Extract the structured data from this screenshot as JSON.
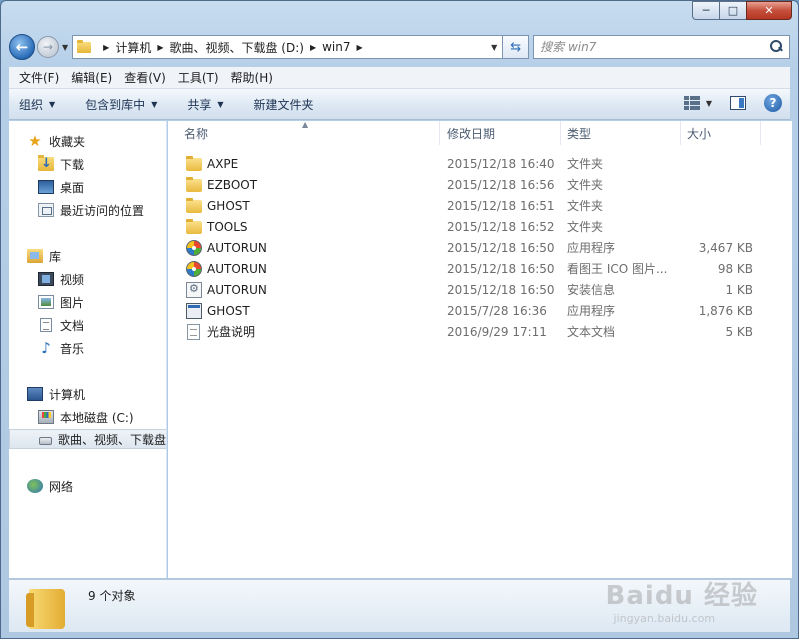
{
  "window": {
    "caption": {
      "minimize": "─",
      "maximize": "□",
      "close": "✕"
    }
  },
  "address": {
    "crumbs": [
      "计算机",
      "歌曲、视频、下载盘 (D:)",
      "win7"
    ],
    "search_placeholder": "搜索 win7"
  },
  "menu": [
    "文件(F)",
    "编辑(E)",
    "查看(V)",
    "工具(T)",
    "帮助(H)"
  ],
  "commands": {
    "organize": "组织",
    "include_in_library": "包含到库中",
    "share": "共享",
    "new_folder": "新建文件夹"
  },
  "nav": {
    "favorites": "收藏夹",
    "downloads": "下载",
    "desktop": "桌面",
    "recent": "最近访问的位置",
    "libraries": "库",
    "videos": "视频",
    "pictures": "图片",
    "documents": "文档",
    "music": "音乐",
    "computer": "计算机",
    "drive_c": "本地磁盘 (C:)",
    "drive_d": "歌曲、视频、下载盘",
    "network": "网络"
  },
  "columns": {
    "name": "名称",
    "date": "修改日期",
    "type": "类型",
    "size": "大小"
  },
  "files": [
    {
      "name": "AXPE",
      "date": "2015/12/18 16:40",
      "type": "文件夹",
      "size": "",
      "icon": "folder"
    },
    {
      "name": "EZBOOT",
      "date": "2015/12/18 16:56",
      "type": "文件夹",
      "size": "",
      "icon": "folder"
    },
    {
      "name": "GHOST",
      "date": "2015/12/18 16:51",
      "type": "文件夹",
      "size": "",
      "icon": "folder"
    },
    {
      "name": "TOOLS",
      "date": "2015/12/18 16:52",
      "type": "文件夹",
      "size": "",
      "icon": "folder"
    },
    {
      "name": "AUTORUN",
      "date": "2015/12/18 16:50",
      "type": "应用程序",
      "size": "3,467 KB",
      "icon": "autorun"
    },
    {
      "name": "AUTORUN",
      "date": "2015/12/18 16:50",
      "type": "看图王 ICO 图片...",
      "size": "98 KB",
      "icon": "autorun"
    },
    {
      "name": "AUTORUN",
      "date": "2015/12/18 16:50",
      "type": "安装信息",
      "size": "1 KB",
      "icon": "inf"
    },
    {
      "name": "GHOST",
      "date": "2015/7/28 16:36",
      "type": "应用程序",
      "size": "1,876 KB",
      "icon": "exe"
    },
    {
      "name": "光盘说明",
      "date": "2016/9/29 17:11",
      "type": "文本文档",
      "size": "5 KB",
      "icon": "txt"
    }
  ],
  "status": {
    "item_count": "9 个对象"
  },
  "watermark": {
    "brand": "Baidu 经验",
    "url": "jingyan.baidu.com"
  }
}
